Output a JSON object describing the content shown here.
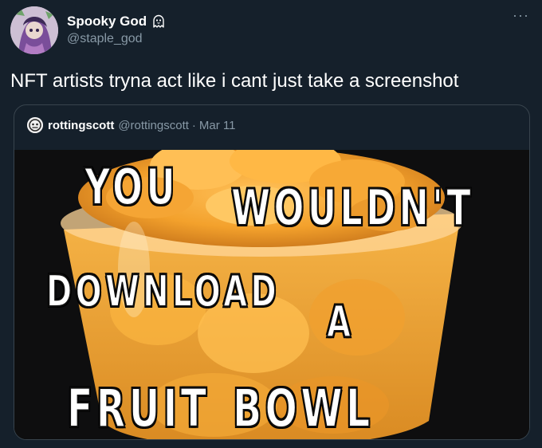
{
  "author": {
    "display_name": "Spooky God",
    "handle": "@staple_god",
    "badge_icon": "ghost-icon"
  },
  "more_label": "···",
  "tweet_text": "NFT artists tryna act like i cant just take a screenshot",
  "quote": {
    "display_name": "rottingscott",
    "handle": "@rottingscott",
    "separator": "·",
    "date": "Mar 11",
    "meme": {
      "word_you": "YOU",
      "word_wouldnt": "WOULDN'T",
      "word_download": "DOWNLOAD",
      "word_a": "A",
      "word_fruit": "FRUIT",
      "word_bowl": "BOWL"
    }
  },
  "colors": {
    "background": "#15202b",
    "secondary_text": "#8899a6",
    "border": "#38444d",
    "fruit": "#f4a531"
  }
}
